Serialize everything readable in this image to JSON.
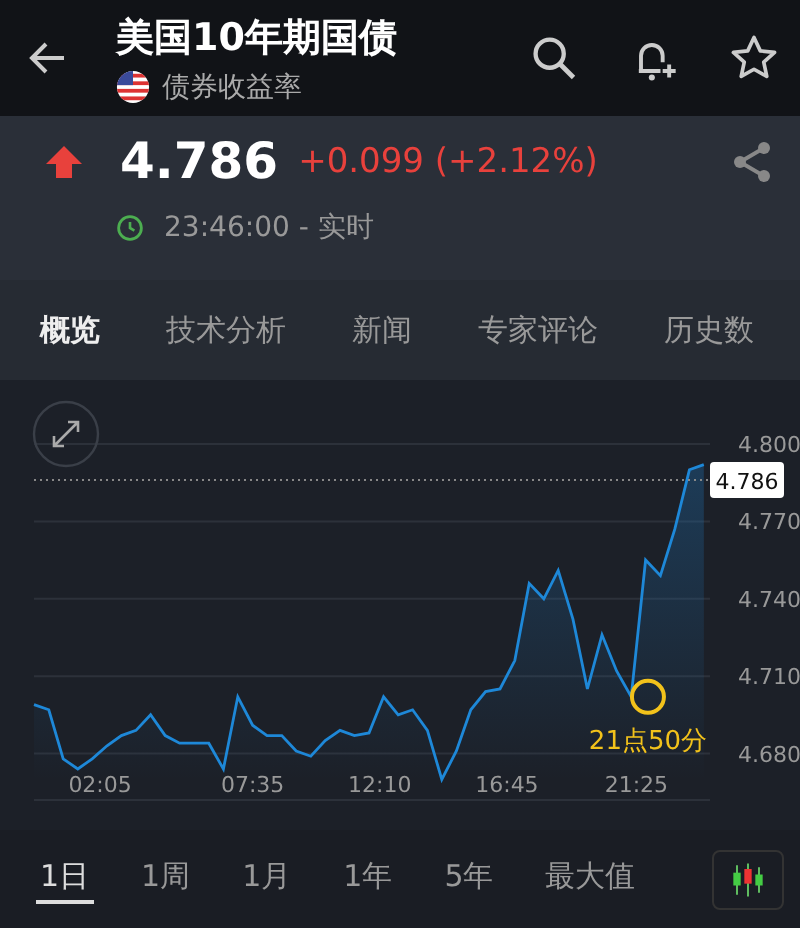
{
  "header": {
    "title": "美国10年期国债",
    "subtitle": "债券收益率"
  },
  "quote": {
    "price": "4.786",
    "change": "+0.099 (+2.12%)",
    "rising": true,
    "time": "23:46:00 - 实时"
  },
  "tabs": [
    {
      "label": "概览",
      "selected": true
    },
    {
      "label": "技术分析",
      "selected": false
    },
    {
      "label": "新闻",
      "selected": false
    },
    {
      "label": "专家评论",
      "selected": false
    },
    {
      "label": "历史数",
      "selected": false
    }
  ],
  "chart": {
    "chart_data": {
      "type": "line",
      "x": [
        -0.3,
        0.23,
        0.75,
        1.28,
        1.8,
        2.33,
        2.85,
        3.38,
        3.9,
        4.43,
        4.95,
        5.48,
        6.0,
        6.53,
        7.05,
        7.58,
        8.1,
        8.63,
        9.15,
        9.68,
        10.2,
        10.73,
        11.25,
        11.78,
        12.3,
        12.83,
        13.35,
        13.88,
        14.4,
        14.93,
        15.45,
        15.98,
        16.5,
        17.03,
        17.55,
        18.08,
        18.6,
        19.13,
        19.65,
        20.18,
        20.7,
        21.23,
        21.75,
        22.28,
        22.8,
        23.33,
        23.85
      ],
      "series": [
        {
          "color": "#1e88d8",
          "values": [
            4.699,
            4.697,
            4.678,
            4.674,
            4.678,
            4.683,
            4.687,
            4.689,
            4.695,
            4.687,
            4.684,
            4.684,
            4.684,
            4.674,
            4.702,
            4.691,
            4.687,
            4.687,
            4.681,
            4.679,
            4.685,
            4.689,
            4.687,
            4.688,
            4.702,
            4.695,
            4.697,
            4.689,
            4.67,
            4.681,
            4.697,
            4.704,
            4.705,
            4.716,
            4.746,
            4.74,
            4.751,
            4.732,
            4.705,
            4.726,
            4.712,
            4.702,
            4.755,
            4.749,
            4.767,
            4.79,
            4.792
          ]
        }
      ],
      "grid": true,
      "yticks": [
        {
          "value": 4.68,
          "label": "4.680"
        },
        {
          "value": 4.71,
          "label": "4.710"
        },
        {
          "value": 4.74,
          "label": "4.740"
        },
        {
          "value": 4.77,
          "label": "4.770"
        },
        {
          "value": 4.8,
          "label": "4.800"
        }
      ],
      "xticks": [
        {
          "value": 2.083,
          "label": "02:05"
        },
        {
          "value": 7.583,
          "label": "07:35"
        },
        {
          "value": 12.167,
          "label": "12:10"
        },
        {
          "value": 16.75,
          "label": "16:45"
        },
        {
          "value": 21.417,
          "label": "21:25"
        }
      ],
      "xlim": [
        -0.3,
        24.07
      ],
      "ylim": [
        4.662,
        4.8
      ],
      "ref_lines": [
        {
          "axis": "y",
          "value": 4.786,
          "label": "4.786"
        }
      ],
      "annotations": [
        {
          "text": "21点50分",
          "x": 21.833,
          "y": 4.702
        }
      ]
    }
  },
  "ranges": [
    {
      "label": "1日",
      "selected": true
    },
    {
      "label": "1周",
      "selected": false
    },
    {
      "label": "1月",
      "selected": false
    },
    {
      "label": "1年",
      "selected": false
    },
    {
      "label": "5年",
      "selected": false
    },
    {
      "label": "最大值",
      "selected": false
    }
  ]
}
